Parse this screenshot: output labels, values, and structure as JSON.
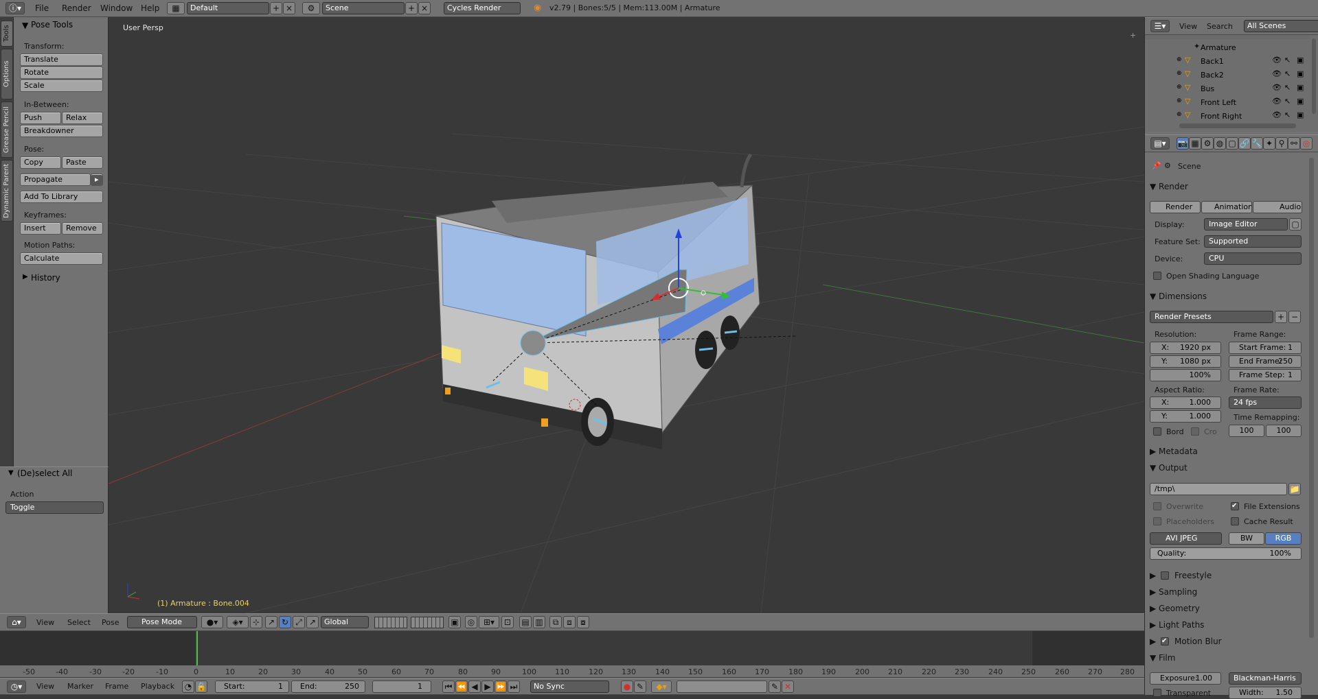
{
  "topbar": {
    "menus": [
      "File",
      "Render",
      "Window",
      "Help"
    ],
    "screen_layout": "Default",
    "scene": "Scene",
    "engine": "Cycles Render",
    "stats": "v2.79 | Bones:5/5 | Mem:113.00M | Armature"
  },
  "tool_tabs": [
    "Tools",
    "Options",
    "Grease Pencil",
    "Dynamic Parent"
  ],
  "tool_shelf": {
    "title": "Pose Tools",
    "transform_label": "Transform:",
    "translate": "Translate",
    "rotate": "Rotate",
    "scale": "Scale",
    "inbetween_label": "In-Between:",
    "push": "Push",
    "relax": "Relax",
    "breakdowner": "Breakdowner",
    "pose_label": "Pose:",
    "copy": "Copy",
    "paste": "Paste",
    "propagate": "Propagate",
    "add_to_library": "Add To Library",
    "keyframes_label": "Keyframes:",
    "insert": "Insert",
    "remove": "Remove",
    "motion_paths_label": "Motion Paths:",
    "calculate": "Calculate",
    "history": "History"
  },
  "operator_panel": {
    "title": "(De)select All",
    "action_label": "Action",
    "action_value": "Toggle"
  },
  "viewport": {
    "view_name": "User Persp",
    "status": "(1) Armature : Bone.004"
  },
  "viewport_header": {
    "menus": [
      "View",
      "Select",
      "Pose"
    ],
    "mode": "Pose Mode",
    "orientation": "Global"
  },
  "outliner": {
    "menus": [
      "View",
      "Search"
    ],
    "filter": "All Scenes",
    "items": [
      "Armature",
      "Back1",
      "Back2",
      "Bus",
      "Front Left",
      "Front Right"
    ]
  },
  "properties": {
    "context": "Scene",
    "render": {
      "header": "Render",
      "tabs": [
        "Render",
        "Animation",
        "Audio"
      ],
      "display_label": "Display:",
      "display_value": "Image Editor",
      "feature_label": "Feature Set:",
      "feature_value": "Supported",
      "device_label": "Device:",
      "device_value": "CPU",
      "osl_label": "Open Shading Language"
    },
    "dimensions": {
      "header": "Dimensions",
      "presets": "Render Presets",
      "resolution_label": "Resolution:",
      "res_x_label": "X:",
      "res_x": "1920 px",
      "res_y_label": "Y:",
      "res_y": "1080 px",
      "res_pct": "100%",
      "frame_range_label": "Frame Range:",
      "start_frame_label": "Start Frame:",
      "start_frame": "1",
      "end_frame_label": "End Frame:",
      "end_frame": "250",
      "frame_step_label": "Frame Step:",
      "frame_step": "1",
      "aspect_label": "Aspect Ratio:",
      "aspect_x_label": "X:",
      "aspect_x": "1.000",
      "aspect_y_label": "Y:",
      "aspect_y": "1.000",
      "frame_rate_label": "Frame Rate:",
      "frame_rate": "24 fps",
      "time_remap_label": "Time Remapping:",
      "remap_old": "100",
      "remap_new": "100",
      "bord": "Bord",
      "cro": "Cro"
    },
    "metadata": "Metadata",
    "output": {
      "header": "Output",
      "path": "/tmp\\",
      "overwrite": "Overwrite",
      "file_extensions": "File Extensions",
      "placeholders": "Placeholders",
      "cache_result": "Cache Result",
      "format": "AVI JPEG",
      "bw": "BW",
      "rgb": "RGB",
      "quality_label": "Quality:",
      "quality": "100%"
    },
    "collapsed": [
      "Freestyle",
      "Sampling",
      "Geometry",
      "Light Paths",
      "Motion Blur"
    ],
    "film": {
      "header": "Film",
      "exposure_label": "Exposure:",
      "exposure": "1.00",
      "filter": "Blackman-Harris",
      "transparent": "Transparent",
      "width_label": "Width:",
      "width": "1.50"
    }
  },
  "timeline": {
    "ticks": [
      "-50",
      "-40",
      "-30",
      "-20",
      "-10",
      "0",
      "10",
      "20",
      "30",
      "40",
      "50",
      "60",
      "70",
      "80",
      "90",
      "100",
      "110",
      "120",
      "130",
      "140",
      "150",
      "160",
      "170",
      "180",
      "190",
      "200",
      "210",
      "220",
      "230",
      "240",
      "250",
      "260",
      "270",
      "280"
    ],
    "menus": [
      "View",
      "Marker",
      "Frame",
      "Playback"
    ],
    "start_label": "Start:",
    "start": "1",
    "end_label": "End:",
    "end": "250",
    "current": "1",
    "sync": "No Sync"
  },
  "colors": {
    "viewport_bg": "#393939",
    "panel_bg": "#727272",
    "selected_blue": "#5680c2",
    "bus_body": "#c3c3c3",
    "bus_stripe": "#5a82d8"
  }
}
